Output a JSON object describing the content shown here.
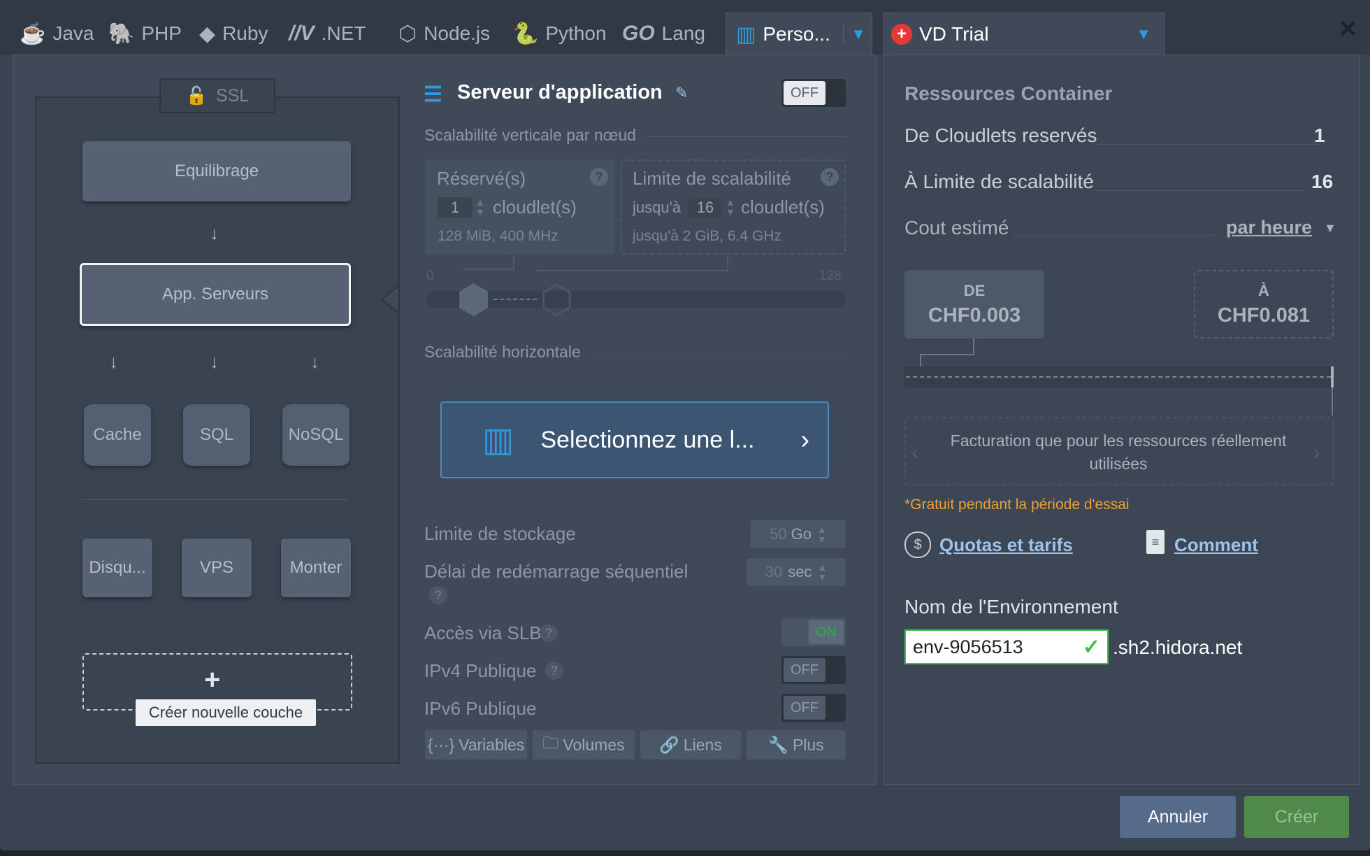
{
  "tabs": [
    {
      "label": "Java",
      "icon": "java-icon"
    },
    {
      "label": "PHP",
      "icon": "php-icon"
    },
    {
      "label": "Ruby",
      "icon": "ruby-icon"
    },
    {
      "label": ".NET",
      "icon": "dotnet-icon"
    },
    {
      "label": "Node.js",
      "icon": "nodejs-icon"
    },
    {
      "label": "Python",
      "icon": "python-icon"
    },
    {
      "label": "Lang",
      "icon": "go-icon",
      "prefix": "GO"
    },
    {
      "label": "Perso...",
      "icon": "custom-icon"
    }
  ],
  "region": {
    "label": "VD Trial",
    "icon": "swiss-flag-icon"
  },
  "close_icon": "close-icon",
  "topology": {
    "ssl": "SSL",
    "balancer": "Equilibrage",
    "app_servers": "App. Serveurs",
    "cache": "Cache",
    "sql": "SQL",
    "nosql": "NoSQL",
    "storage": "Disqu...",
    "vps": "VPS",
    "mount": "Monter",
    "new_layer_tooltip": "Créer nouvelle couche"
  },
  "config": {
    "title": "Serveur d'application",
    "title_toggle": "OFF",
    "vertical_heading": "Scalabilité verticale par nœud",
    "reserved": {
      "label": "Réservé(s)",
      "value": "1",
      "unit": "cloudlet(s)",
      "spec": "128 MiB, 400 MHz"
    },
    "limit": {
      "label": "Limite de scalabilité",
      "prefix": "jusqu'à",
      "value": "16",
      "unit": "cloudlet(s)",
      "spec": "jusqu'à 2 GiB, 6.4 GHz"
    },
    "slider": {
      "min_label": "0",
      "max_label": "128",
      "min": 0,
      "max": 128,
      "reserved": 1,
      "limit": 16
    },
    "horizontal_heading": "Scalabilité horizontale",
    "select_instance": "Selectionnez une l...",
    "storage_limit": {
      "label": "Limite de stockage",
      "value": "50",
      "unit": "Go"
    },
    "restart_delay": {
      "label": "Délai de redémarrage séquentiel",
      "value": "30",
      "unit": "sec"
    },
    "slb_access": {
      "label": "Accès via SLB",
      "state": "ON"
    },
    "ipv4": {
      "label": "IPv4 Publique",
      "state": "OFF"
    },
    "ipv6": {
      "label": "IPv6 Publique",
      "state": "OFF"
    },
    "buttons": {
      "variables": "Variables",
      "volumes": "Volumes",
      "links": "Liens",
      "more": "Plus"
    }
  },
  "resources": {
    "heading": "Ressources Container",
    "reserved_cloudlets": {
      "label": "De Cloudlets reservés",
      "value": "1"
    },
    "scaling_limit": {
      "label": "À Limite de scalabilité",
      "value": "16"
    },
    "cost": {
      "label": "Cout estimé",
      "period": "par heure"
    },
    "from": {
      "label": "DE",
      "price": "CHF0.003"
    },
    "to": {
      "label": "À",
      "price": "CHF0.081"
    },
    "billing_note": "Facturation que pour les ressources réellement utilisées",
    "trial_note": "*Gratuit pendant la période d'essai",
    "quotas_link": "Quotas et tarifs",
    "how_link": "Comment",
    "env_label": "Nom de l'Environnement",
    "env_value": "env-9056513",
    "env_suffix": ".sh2.hidora.net"
  },
  "footer": {
    "cancel": "Annuler",
    "create": "Créer"
  },
  "colors": {
    "accent": "#2e9cdb",
    "create": "#4f8a4b",
    "trial": "#f0a030",
    "valid": "#3fbf4a"
  }
}
